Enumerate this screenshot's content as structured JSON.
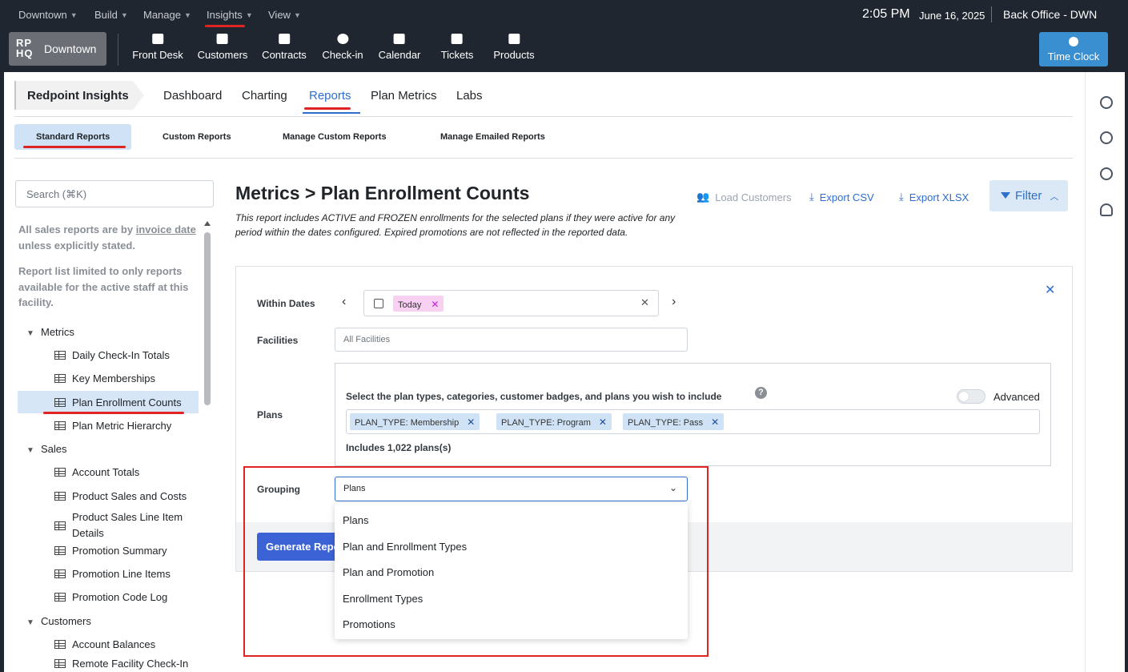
{
  "topmenu": {
    "items": [
      "Downtown",
      "Build",
      "Manage",
      "Insights",
      "View"
    ],
    "time": "2:05 PM",
    "date": "June 16, 2025",
    "office": "Back Office - DWN"
  },
  "navbar": {
    "logo_mark": "RP HQ",
    "location": "Downtown",
    "items": [
      {
        "label": "Front Desk",
        "icon": "cart-icon"
      },
      {
        "label": "Customers",
        "icon": "users-icon"
      },
      {
        "label": "Contracts",
        "icon": "contracts-icon"
      },
      {
        "label": "Check-in",
        "icon": "arrow-circle-icon"
      },
      {
        "label": "Calendar",
        "icon": "calendar-icon"
      },
      {
        "label": "Tickets",
        "icon": "chat-icon"
      },
      {
        "label": "Products",
        "icon": "box-icon"
      }
    ],
    "timeclock": "Time Clock"
  },
  "insights": {
    "title": "Redpoint Insights",
    "tabs": [
      "Dashboard",
      "Charting",
      "Reports",
      "Plan Metrics",
      "Labs"
    ],
    "active_tab": "Reports",
    "subtabs": [
      "Standard Reports",
      "Custom Reports",
      "Manage Custom Reports",
      "Manage Emailed Reports"
    ]
  },
  "sidebar": {
    "search_placeholder": "Search (⌘K)",
    "note1_prefix": "All sales reports are by ",
    "note1_link": "invoice date",
    "note1_suffix": " unless explicitly stated.",
    "note2": "Report list limited to only reports available for the active staff at this facility.",
    "groups": [
      {
        "name": "Metrics",
        "items": [
          "Daily Check-In Totals",
          "Key Memberships",
          "Plan Enrollment Counts",
          "Plan Metric Hierarchy"
        ]
      },
      {
        "name": "Sales",
        "items": [
          "Account Totals",
          "Product Sales and Costs",
          "Product Sales Line Item Details",
          "Promotion Summary",
          "Promotion Line Items",
          "Promotion Code Log"
        ]
      },
      {
        "name": "Customers",
        "items": [
          "Account Balances",
          "Remote Facility Check-In"
        ]
      }
    ]
  },
  "report": {
    "title": "Metrics > Plan Enrollment Counts",
    "description": "This report includes ACTIVE and FROZEN enrollments for the selected plans if they were active for any period within the dates configured. Expired promotions are not reflected in the reported data.",
    "actions": {
      "load": "Load Customers",
      "csv": "Export CSV",
      "xlsx": "Export XLSX",
      "filter": "Filter"
    }
  },
  "filters": {
    "within_dates_label": "Within Dates",
    "date_chip": "Today",
    "facilities_label": "Facilities",
    "facilities_placeholder": "All Facilities",
    "plans_label": "Plans",
    "plans_question": "Select the plan types, categories, customer badges, and plans you wish to include",
    "advanced_label": "Advanced",
    "plan_chips": [
      "PLAN_TYPE: Membership",
      "PLAN_TYPE: Program",
      "PLAN_TYPE: Pass"
    ],
    "includes": "Includes 1,022 plans(s)",
    "grouping_label": "Grouping",
    "grouping_value": "Plans",
    "grouping_options": [
      "Plans",
      "Plan and Enrollment Types",
      "Plan and Promotion",
      "Enrollment Types",
      "Promotions"
    ],
    "generate": "Generate Report"
  },
  "colors": {
    "accent": "#2f6ecb",
    "highlight": "#e02424",
    "dark": "#1f2630"
  }
}
